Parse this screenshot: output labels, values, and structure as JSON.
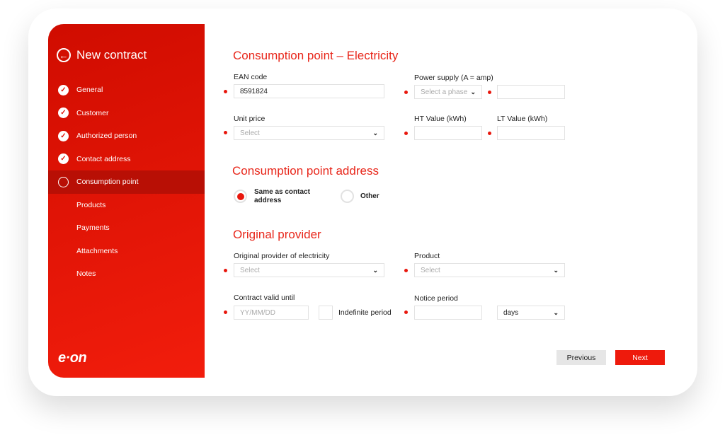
{
  "sidebar": {
    "title": "New contract",
    "items": [
      {
        "label": "General",
        "state": "done"
      },
      {
        "label": "Customer",
        "state": "done"
      },
      {
        "label": "Authorized person",
        "state": "done"
      },
      {
        "label": "Contact address",
        "state": "done"
      },
      {
        "label": "Consumption point",
        "state": "current"
      },
      {
        "label": "Products",
        "state": "todo"
      },
      {
        "label": "Payments",
        "state": "todo"
      },
      {
        "label": "Attachments",
        "state": "todo"
      },
      {
        "label": "Notes",
        "state": "todo"
      }
    ],
    "logo": "e·on"
  },
  "section1": {
    "title": "Consumption point – Electricity",
    "ean_label": "EAN code",
    "ean_value": "8591824",
    "power_label": "Power supply (A = amp)",
    "phase_placeholder": "Select a phase",
    "unit_label": "Unit price",
    "unit_placeholder": "Select",
    "ht_label": "HT Value (kWh)",
    "lt_label": "LT Value (kWh)"
  },
  "section2": {
    "title": "Consumption point address",
    "opt1": "Same as contact address",
    "opt2": "Other",
    "selected": "Same as contact address"
  },
  "section3": {
    "title": "Original provider",
    "provider_label": "Original provider of electricity",
    "provider_placeholder": "Select",
    "product_label": "Product",
    "product_placeholder": "Select",
    "valid_label": "Contract valid until",
    "valid_placeholder": "YY/MM/DD",
    "indefinite_label": "Indefinite period",
    "notice_label": "Notice period",
    "notice_unit": "days"
  },
  "buttons": {
    "previous": "Previous",
    "next": "Next"
  },
  "colors": {
    "accent": "#e8160c"
  }
}
